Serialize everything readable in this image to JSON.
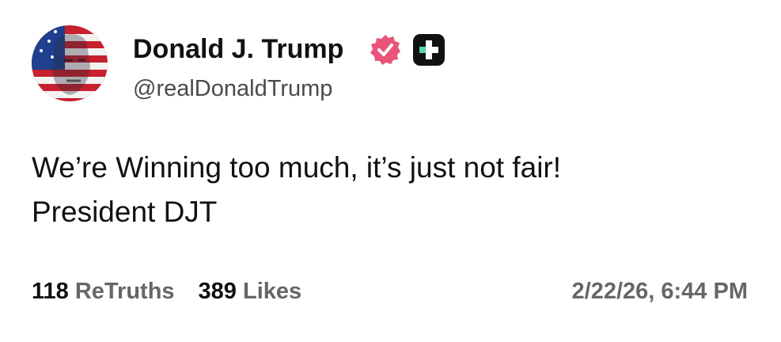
{
  "author": {
    "display_name": "Donald J. Trump",
    "handle": "@realDonaldTrump",
    "verified": true,
    "verified_color": "#e8547a",
    "platform_badge_color": "#111111",
    "platform_badge_accent": "#56d6b4"
  },
  "post": {
    "lines": [
      "We’re Winning too much, it’s just not fair!",
      "President DJT"
    ]
  },
  "stats": {
    "retruths_count": "118",
    "retruths_label": "ReTruths",
    "likes_count": "389",
    "likes_label": "Likes"
  },
  "timestamp": "2/22/26, 6:44 PM"
}
